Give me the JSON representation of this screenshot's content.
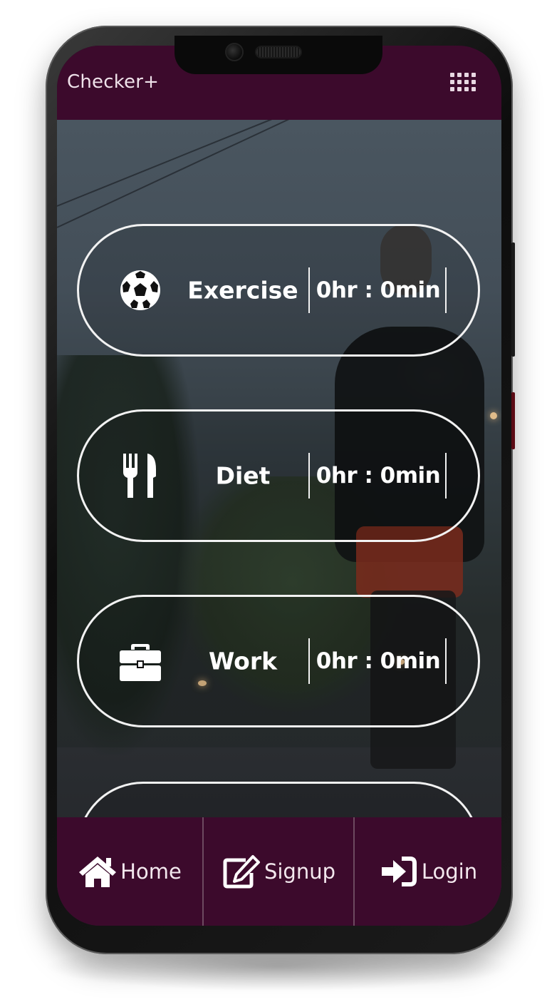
{
  "app": {
    "title": "Checker+",
    "menu_icon": "grid-menu-icon"
  },
  "colors": {
    "bar_background": "#3c0a2c",
    "card_border": "#f2f2f2",
    "text": "#ffffff"
  },
  "activities": [
    {
      "label": "Exercise",
      "time": "0hr : 0min",
      "icon": "soccer-ball-icon"
    },
    {
      "label": "Diet",
      "time": "0hr : 0min",
      "icon": "fork-knife-icon"
    },
    {
      "label": "Work",
      "time": "0hr : 0min",
      "icon": "briefcase-icon"
    }
  ],
  "bottom_nav": [
    {
      "label": "Home",
      "icon": "home-icon"
    },
    {
      "label": "Signup",
      "icon": "edit-icon"
    },
    {
      "label": "Login",
      "icon": "sign-in-icon"
    }
  ]
}
